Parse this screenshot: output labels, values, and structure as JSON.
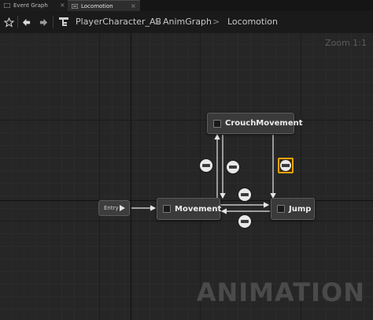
{
  "tabs": [
    {
      "label": "Event Graph"
    },
    {
      "label": "Locomotion"
    }
  ],
  "breadcrumb": {
    "items": [
      "PlayerCharacter_AB",
      "AnimGraph",
      "Locomotion"
    ],
    "separator": ">"
  },
  "graph": {
    "zoom_label": "Zoom 1:1",
    "watermark": "ANIMATION",
    "entry_label": "Entry",
    "states": {
      "crouch": "CrouchMovement",
      "movement": "Movement",
      "jump": "Jump"
    }
  },
  "colors": {
    "selection_outline": "#e8a30a",
    "background": "#262626"
  }
}
